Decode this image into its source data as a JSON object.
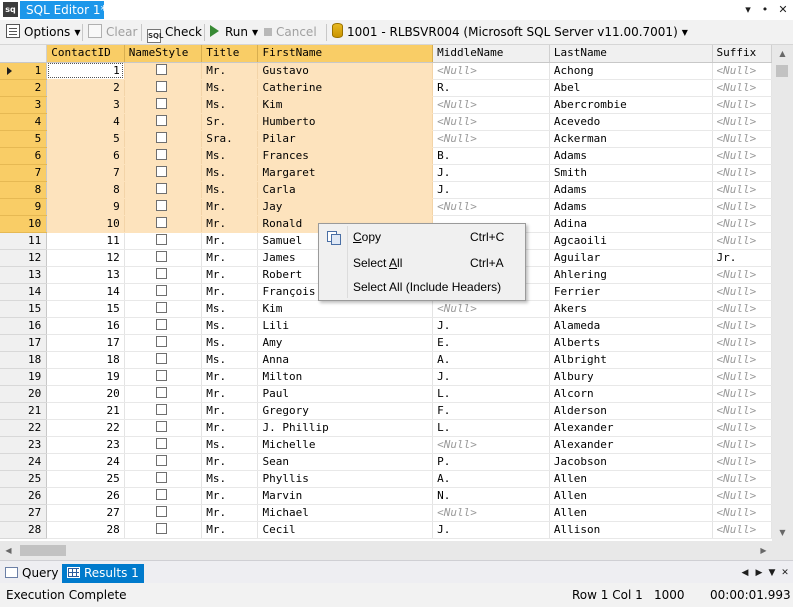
{
  "window": {
    "app_icon_text": "sq",
    "tab_title": "SQL Editor 1*"
  },
  "toolbar": {
    "options": "Options",
    "clear": "Clear",
    "check": "Check",
    "run": "Run",
    "cancel": "Cancel",
    "connection": "1001 - RLBSVR004 (Microsoft SQL Server v11.00.7001)",
    "check_icon_text": "SQL"
  },
  "grid": {
    "columns": [
      "ContactID",
      "NameStyle",
      "Title",
      "FirstName",
      "MiddleName",
      "LastName",
      "Suffix"
    ],
    "highlighted_columns": [
      0,
      1,
      2,
      3
    ],
    "null_text": "<Null>",
    "rows": [
      {
        "row": "1",
        "ContactID": "1",
        "Title": "Mr.",
        "FirstName": "Gustavo",
        "MiddleName": "<Null>",
        "LastName": "Achong",
        "Suffix": "<Null>"
      },
      {
        "row": "2",
        "ContactID": "2",
        "Title": "Ms.",
        "FirstName": "Catherine",
        "MiddleName": "R.",
        "LastName": "Abel",
        "Suffix": "<Null>"
      },
      {
        "row": "3",
        "ContactID": "3",
        "Title": "Ms.",
        "FirstName": "Kim",
        "MiddleName": "<Null>",
        "LastName": "Abercrombie",
        "Suffix": "<Null>"
      },
      {
        "row": "4",
        "ContactID": "4",
        "Title": "Sr.",
        "FirstName": "Humberto",
        "MiddleName": "<Null>",
        "LastName": "Acevedo",
        "Suffix": "<Null>"
      },
      {
        "row": "5",
        "ContactID": "5",
        "Title": "Sra.",
        "FirstName": "Pilar",
        "MiddleName": "<Null>",
        "LastName": "Ackerman",
        "Suffix": "<Null>"
      },
      {
        "row": "6",
        "ContactID": "6",
        "Title": "Ms.",
        "FirstName": "Frances",
        "MiddleName": "B.",
        "LastName": "Adams",
        "Suffix": "<Null>"
      },
      {
        "row": "7",
        "ContactID": "7",
        "Title": "Ms.",
        "FirstName": "Margaret",
        "MiddleName": "J.",
        "LastName": "Smith",
        "Suffix": "<Null>"
      },
      {
        "row": "8",
        "ContactID": "8",
        "Title": "Ms.",
        "FirstName": "Carla",
        "MiddleName": "J.",
        "LastName": "Adams",
        "Suffix": "<Null>"
      },
      {
        "row": "9",
        "ContactID": "9",
        "Title": "Mr.",
        "FirstName": "Jay",
        "MiddleName": "<Null>",
        "LastName": "Adams",
        "Suffix": "<Null>"
      },
      {
        "row": "10",
        "ContactID": "10",
        "Title": "Mr.",
        "FirstName": "Ronald",
        "MiddleName": "",
        "LastName": "Adina",
        "Suffix": "<Null>"
      },
      {
        "row": "11",
        "ContactID": "11",
        "Title": "Mr.",
        "FirstName": "Samuel",
        "MiddleName": "",
        "LastName": "Agcaoili",
        "Suffix": "<Null>"
      },
      {
        "row": "12",
        "ContactID": "12",
        "Title": "Mr.",
        "FirstName": "James",
        "MiddleName": "",
        "LastName": "Aguilar",
        "Suffix": "Jr."
      },
      {
        "row": "13",
        "ContactID": "13",
        "Title": "Mr.",
        "FirstName": "Robert",
        "MiddleName": "",
        "LastName": "Ahlering",
        "Suffix": "<Null>"
      },
      {
        "row": "14",
        "ContactID": "14",
        "Title": "Mr.",
        "FirstName": "François",
        "MiddleName": "",
        "LastName": "Ferrier",
        "Suffix": "<Null>"
      },
      {
        "row": "15",
        "ContactID": "15",
        "Title": "Ms.",
        "FirstName": "Kim",
        "MiddleName": "<Null>",
        "LastName": "Akers",
        "Suffix": "<Null>"
      },
      {
        "row": "16",
        "ContactID": "16",
        "Title": "Ms.",
        "FirstName": "Lili",
        "MiddleName": "J.",
        "LastName": "Alameda",
        "Suffix": "<Null>"
      },
      {
        "row": "17",
        "ContactID": "17",
        "Title": "Ms.",
        "FirstName": "Amy",
        "MiddleName": "E.",
        "LastName": "Alberts",
        "Suffix": "<Null>"
      },
      {
        "row": "18",
        "ContactID": "18",
        "Title": "Ms.",
        "FirstName": "Anna",
        "MiddleName": "A.",
        "LastName": "Albright",
        "Suffix": "<Null>"
      },
      {
        "row": "19",
        "ContactID": "19",
        "Title": "Mr.",
        "FirstName": "Milton",
        "MiddleName": "J.",
        "LastName": "Albury",
        "Suffix": "<Null>"
      },
      {
        "row": "20",
        "ContactID": "20",
        "Title": "Mr.",
        "FirstName": "Paul",
        "MiddleName": "L.",
        "LastName": "Alcorn",
        "Suffix": "<Null>"
      },
      {
        "row": "21",
        "ContactID": "21",
        "Title": "Mr.",
        "FirstName": "Gregory",
        "MiddleName": "F.",
        "LastName": "Alderson",
        "Suffix": "<Null>"
      },
      {
        "row": "22",
        "ContactID": "22",
        "Title": "Mr.",
        "FirstName": "J. Phillip",
        "MiddleName": "L.",
        "LastName": "Alexander",
        "Suffix": "<Null>"
      },
      {
        "row": "23",
        "ContactID": "23",
        "Title": "Ms.",
        "FirstName": "Michelle",
        "MiddleName": "<Null>",
        "LastName": "Alexander",
        "Suffix": "<Null>"
      },
      {
        "row": "24",
        "ContactID": "24",
        "Title": "Mr.",
        "FirstName": "Sean",
        "MiddleName": "P.",
        "LastName": "Jacobson",
        "Suffix": "<Null>"
      },
      {
        "row": "25",
        "ContactID": "25",
        "Title": "Ms.",
        "FirstName": "Phyllis",
        "MiddleName": "A.",
        "LastName": "Allen",
        "Suffix": "<Null>"
      },
      {
        "row": "26",
        "ContactID": "26",
        "Title": "Mr.",
        "FirstName": "Marvin",
        "MiddleName": "N.",
        "LastName": "Allen",
        "Suffix": "<Null>"
      },
      {
        "row": "27",
        "ContactID": "27",
        "Title": "Mr.",
        "FirstName": "Michael",
        "MiddleName": "<Null>",
        "LastName": "Allen",
        "Suffix": "<Null>"
      },
      {
        "row": "28",
        "ContactID": "28",
        "Title": "Mr.",
        "FirstName": "Cecil",
        "MiddleName": "J.",
        "LastName": "Allison",
        "Suffix": "<Null>"
      }
    ],
    "selected_rows": 10,
    "current_row": 1
  },
  "context_menu": {
    "items": [
      {
        "label": "Copy",
        "shortcut": "Ctrl+C",
        "icon": "copy-icon"
      },
      {
        "label": "Select All",
        "shortcut": "Ctrl+A"
      },
      {
        "label": "Select All (Include Headers)",
        "shortcut": ""
      }
    ]
  },
  "bottom_tabs": {
    "query": "Query",
    "results": "Results 1"
  },
  "status": {
    "message": "Execution Complete",
    "position": "Row 1 Col 1",
    "count": "1000",
    "elapsed": "00:00:01.993"
  },
  "colors": {
    "accent": "#007acc",
    "title_tab": "#1c97ea",
    "selection_header": "#f9cd66",
    "selection_cell": "#fde3bd",
    "null_text": "#9a9a9a"
  }
}
